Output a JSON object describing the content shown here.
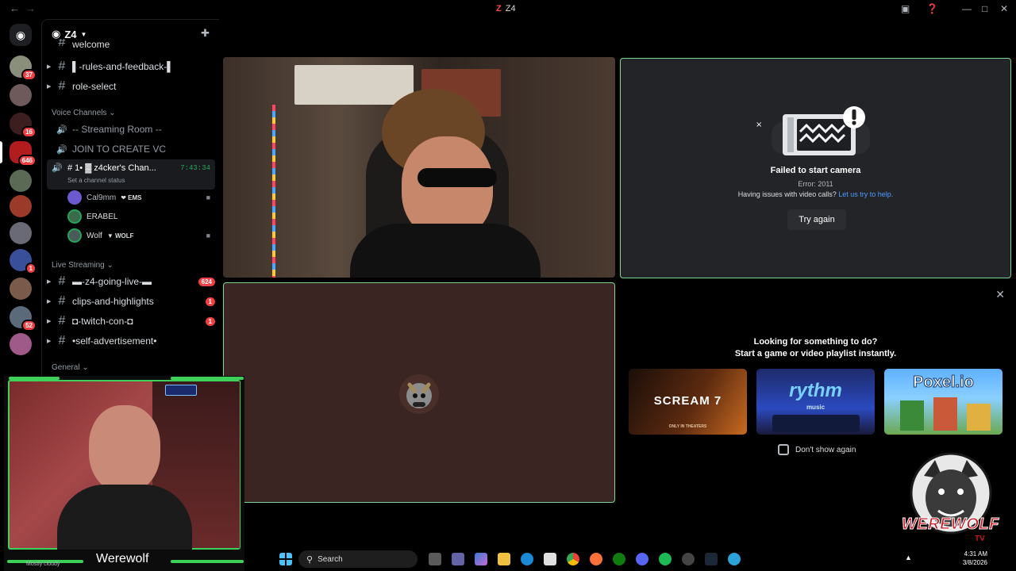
{
  "window": {
    "title": "Z4"
  },
  "server": {
    "name": "Z4"
  },
  "rail_badges": [
    "37",
    "16",
    "646",
    "1",
    "52"
  ],
  "channels_top": [
    {
      "name": "welcome"
    },
    {
      "name": "▌-rules-and-feedback-▌"
    },
    {
      "name": "role-select"
    }
  ],
  "voice_category": "Voice Channels",
  "voice_channels": [
    {
      "name": "-- Streaming Room --"
    },
    {
      "name": "JOIN TO CREATE VC"
    }
  ],
  "active_vc": {
    "name": "# 1• ▓ z4cker's Chan...",
    "time": "7:43:34",
    "status_hint": "Set a channel status"
  },
  "vc_users": [
    {
      "name": "Cal9mm",
      "tag": "❤ EMS"
    },
    {
      "name": "ERABEL",
      "tag": ""
    },
    {
      "name": "Wolf",
      "tag": "▼ WOLF"
    }
  ],
  "live_category": "Live Streaming",
  "live_channels": [
    {
      "name": "▬-z4-going-live-▬",
      "badge": "624"
    },
    {
      "name": "clips-and-highlights",
      "badge": "1"
    },
    {
      "name": "◘-twitch-con-◘",
      "badge": "1"
    },
    {
      "name": "•self-advertisement•",
      "badge": ""
    }
  ],
  "general_category": "General",
  "camera_error": {
    "title": "Failed to start camera",
    "code": "Error: 2011",
    "help_prefix": "Having issues with video calls?",
    "help_link": "Let us try to help.",
    "retry_label": "Try again"
  },
  "activity": {
    "heading_line1": "Looking for something to do?",
    "heading_line2": "Start a game or video playlist instantly.",
    "cards": [
      {
        "name": "SCREAM 7",
        "sub": "ONLY IN THEATERS"
      },
      {
        "name": "rythm",
        "sub": "music"
      },
      {
        "name": "Poxel.io",
        "sub": ""
      }
    ],
    "dont_show_label": "Don't show again"
  },
  "webcam": {
    "name": "Werewolf",
    "caption": "Mostly cloudy"
  },
  "taskbar": {
    "search_placeholder": "Search",
    "time": "4:31 AM",
    "date": "3/8/2026"
  },
  "brand": {
    "name": "WEREWOLF",
    "sub": "TV"
  },
  "colors": {
    "accent_green": "#3dd15a",
    "speaking_border": "#77d98f",
    "danger": "#f23f43",
    "link": "#4e9cff"
  }
}
